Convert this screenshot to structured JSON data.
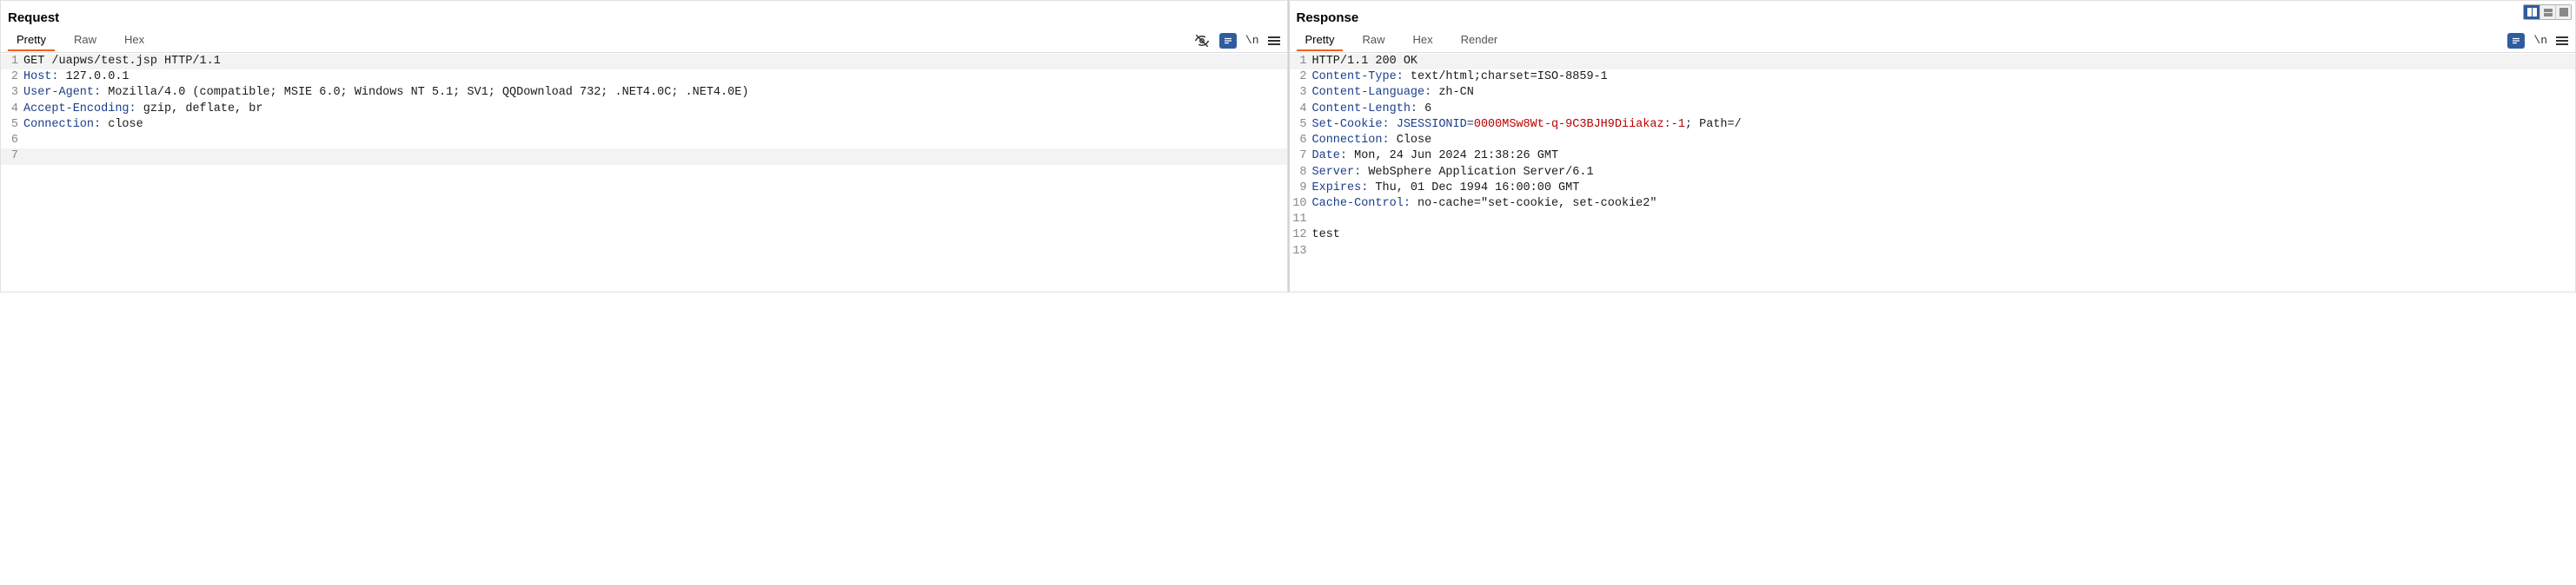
{
  "request": {
    "title": "Request",
    "tabs": [
      "Pretty",
      "Raw",
      "Hex"
    ],
    "activeTab": 0,
    "wrapLabel": "\\n",
    "lines": [
      {
        "num": 1,
        "hl": true,
        "segs": [
          {
            "t": "plain",
            "v": "GET /uapws/test.jsp HTTP/1.1"
          }
        ]
      },
      {
        "num": 2,
        "segs": [
          {
            "t": "hdr",
            "v": "Host"
          },
          {
            "t": "colon",
            "v": ": "
          },
          {
            "t": "plain",
            "v": "127.0.0.1"
          }
        ]
      },
      {
        "num": 3,
        "segs": [
          {
            "t": "hdr",
            "v": "User-Agent"
          },
          {
            "t": "colon",
            "v": ": "
          },
          {
            "t": "plain",
            "v": "Mozilla/4.0 (compatible; MSIE 6.0; Windows NT 5.1; SV1; QQDownload 732; .NET4.0C; .NET4.0E)"
          }
        ]
      },
      {
        "num": 4,
        "segs": [
          {
            "t": "hdr",
            "v": "Accept-Encoding"
          },
          {
            "t": "colon",
            "v": ": "
          },
          {
            "t": "plain",
            "v": "gzip, deflate, br"
          }
        ]
      },
      {
        "num": 5,
        "segs": [
          {
            "t": "hdr",
            "v": "Connection"
          },
          {
            "t": "colon",
            "v": ": "
          },
          {
            "t": "plain",
            "v": "close"
          }
        ]
      },
      {
        "num": 6,
        "segs": []
      },
      {
        "num": 7,
        "hl": true,
        "segs": []
      }
    ]
  },
  "response": {
    "title": "Response",
    "tabs": [
      "Pretty",
      "Raw",
      "Hex",
      "Render"
    ],
    "activeTab": 0,
    "wrapLabel": "\\n",
    "lines": [
      {
        "num": 1,
        "hl": true,
        "segs": [
          {
            "t": "plain",
            "v": "HTTP/1.1 200 OK"
          }
        ]
      },
      {
        "num": 2,
        "segs": [
          {
            "t": "hdr",
            "v": "Content-Type"
          },
          {
            "t": "colon",
            "v": ": "
          },
          {
            "t": "plain",
            "v": "text/html;charset=ISO-8859-1"
          }
        ]
      },
      {
        "num": 3,
        "segs": [
          {
            "t": "hdr",
            "v": "Content-Language"
          },
          {
            "t": "colon",
            "v": ": "
          },
          {
            "t": "plain",
            "v": "zh-CN"
          }
        ]
      },
      {
        "num": 4,
        "segs": [
          {
            "t": "hdr",
            "v": "Content-Length"
          },
          {
            "t": "colon",
            "v": ": "
          },
          {
            "t": "plain",
            "v": "6"
          }
        ]
      },
      {
        "num": 5,
        "segs": [
          {
            "t": "hdr",
            "v": "Set-Cookie"
          },
          {
            "t": "colon",
            "v": ": "
          },
          {
            "t": "hdr",
            "v": "JSESSIONID="
          },
          {
            "t": "red",
            "v": "0000MSw8Wt-q-9C3BJH9Diiakaz:-1"
          },
          {
            "t": "plain",
            "v": "; Path=/"
          }
        ]
      },
      {
        "num": 6,
        "segs": [
          {
            "t": "hdr",
            "v": "Connection"
          },
          {
            "t": "colon",
            "v": ": "
          },
          {
            "t": "plain",
            "v": "Close"
          }
        ]
      },
      {
        "num": 7,
        "segs": [
          {
            "t": "hdr",
            "v": "Date"
          },
          {
            "t": "colon",
            "v": ": "
          },
          {
            "t": "plain",
            "v": "Mon, 24 Jun 2024 21:38:26 GMT"
          }
        ]
      },
      {
        "num": 8,
        "segs": [
          {
            "t": "hdr",
            "v": "Server"
          },
          {
            "t": "colon",
            "v": ": "
          },
          {
            "t": "plain",
            "v": "WebSphere Application Server/6.1"
          }
        ]
      },
      {
        "num": 9,
        "segs": [
          {
            "t": "hdr",
            "v": "Expires"
          },
          {
            "t": "colon",
            "v": ": "
          },
          {
            "t": "plain",
            "v": "Thu, 01 Dec 1994 16:00:00 GMT"
          }
        ]
      },
      {
        "num": 10,
        "segs": [
          {
            "t": "hdr",
            "v": "Cache-Control"
          },
          {
            "t": "colon",
            "v": ": "
          },
          {
            "t": "plain",
            "v": "no-cache=\"set-cookie, set-cookie2\""
          }
        ]
      },
      {
        "num": 11,
        "segs": []
      },
      {
        "num": 12,
        "segs": [
          {
            "t": "plain",
            "v": "test"
          }
        ]
      },
      {
        "num": 13,
        "segs": []
      }
    ]
  }
}
